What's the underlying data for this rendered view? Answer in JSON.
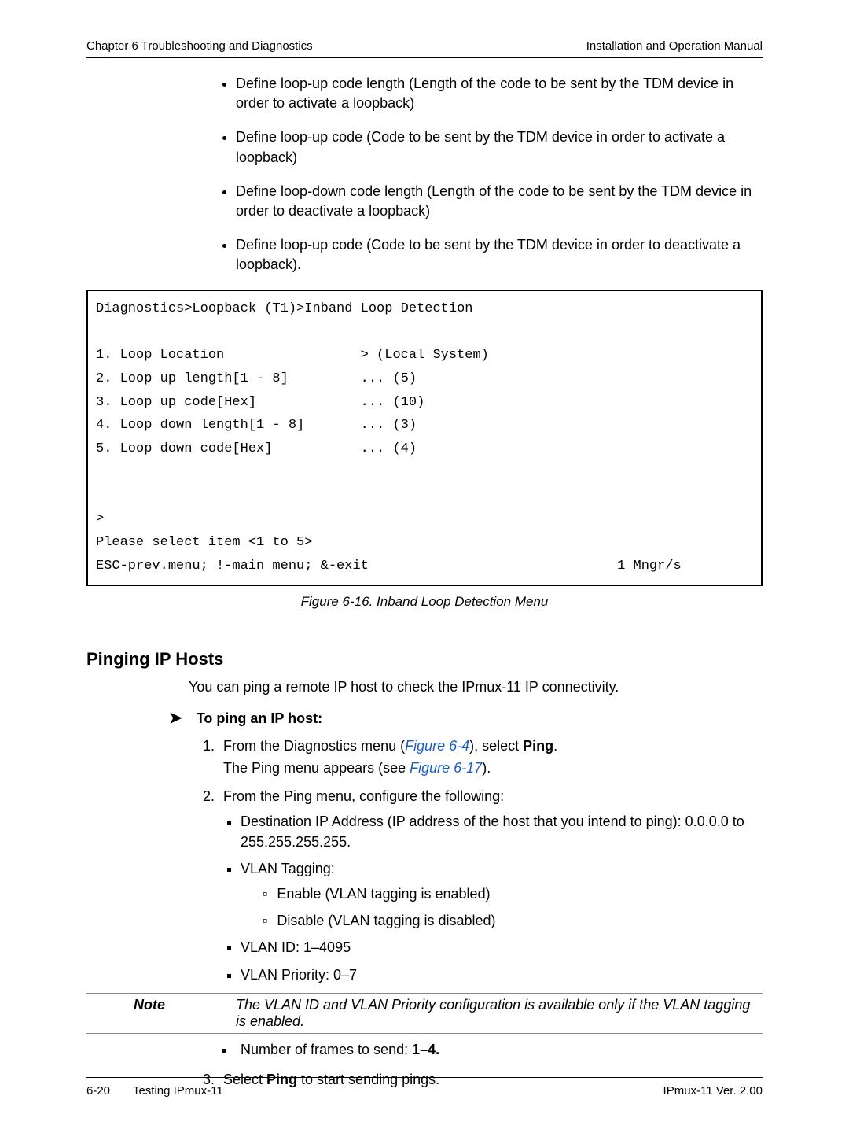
{
  "header": {
    "left": "Chapter 6  Troubleshooting and Diagnostics",
    "right": "Installation and Operation Manual"
  },
  "top_bullets": [
    "Define loop-up code length (Length of the code to be sent by the TDM device in order to activate a loopback)",
    "Define loop-up code (Code to be sent by the TDM device in order to activate a loopback)",
    "Define loop-down code length (Length of the code to be sent by the TDM device in order to deactivate a loopback)",
    "Define loop-up code (Code to be sent by the TDM device in order to deactivate a loopback)."
  ],
  "terminal": {
    "text": "Diagnostics>Loopback (T1)>Inband Loop Detection\n\n1. Loop Location                 > (Local System)\n2. Loop up length[1 - 8]         ... (5)\n3. Loop up code[Hex]             ... (10)\n4. Loop down length[1 - 8]       ... (3)\n5. Loop down code[Hex]           ... (4)\n\n\n>\nPlease select item <1 to 5>\nESC-prev.menu; !-main menu; &-exit                               1 Mngr/s"
  },
  "figure_caption": "Figure 6-16.  Inband Loop Detection Menu",
  "section_heading": "Pinging IP Hosts",
  "intro_para": "You can ping a remote IP host to check the IPmux-11 IP connectivity.",
  "proc_heading": "To ping an IP host:",
  "step1": {
    "pre": "From the Diagnostics menu (",
    "link": "Figure 6-4",
    "mid": "), select ",
    "bold": "Ping",
    "post": ".",
    "sub_pre": "The Ping menu appears (see ",
    "sub_link": "Figure 6-17",
    "sub_post": ")."
  },
  "step2": {
    "intro": "From the Ping menu, configure the following:",
    "b1": "Destination IP Address (IP address of the host that you intend to ping): 0.0.0.0 to 255.255.255.255.",
    "b2": "VLAN Tagging:",
    "b2a": "Enable (VLAN tagging is enabled)",
    "b2b": "Disable (VLAN tagging is disabled)",
    "b3": "VLAN ID: 1–4095",
    "b4": "VLAN Priority: 0–7"
  },
  "note": {
    "label": "Note",
    "text": "The VLAN ID and VLAN Priority configuration is available only if the VLAN tagging is enabled."
  },
  "after_note": {
    "pre": "Number of frames to send: ",
    "bold": "1–4."
  },
  "step3": {
    "pre": "Select ",
    "bold": "Ping",
    "post": " to start sending pings."
  },
  "footer": {
    "left_page": "6-20",
    "left_title": "Testing IPmux-11",
    "right": "IPmux-11 Ver. 2.00"
  }
}
